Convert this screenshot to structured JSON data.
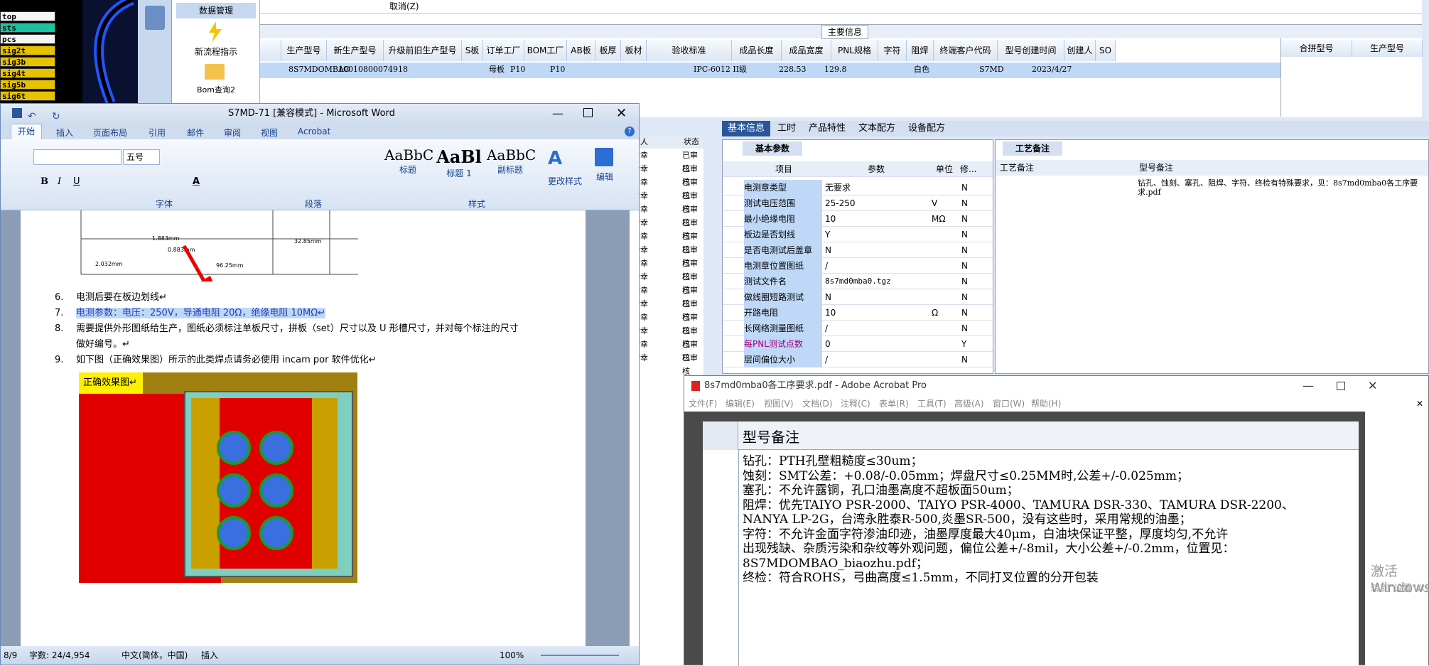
{
  "cad_layers": [
    "top",
    "sts",
    "pcs",
    "sig2t",
    "sig3b",
    "sig4t",
    "sig5b",
    "sig6t"
  ],
  "nav": {
    "data_mgmt": "数据管理",
    "new_flow": "新流程指示",
    "bom": "Bom查询2"
  },
  "erp_top": {
    "cancel": "取消(Z)",
    "main_info": "主要信息"
  },
  "grid_headers": [
    "生产型号",
    "新生产型号",
    "升级前旧生产型号",
    "S板",
    "订单工厂",
    "BOM工厂",
    "AB板",
    "板厚",
    "板材",
    "验收标准",
    "成品长度",
    "成品宽度",
    "PNL规格",
    "字符",
    "阻焊",
    "终端客户代码",
    "型号创建时间",
    "创建人",
    "SO"
  ],
  "grid_row": {
    "model": "8S7MDOMBAO",
    "new_model": "10010800074918",
    "s_board": "母板",
    "order_factory": "P10",
    "bom_factory": "P10",
    "standard": "IPC-6012 II级",
    "length": "228.53",
    "width": "129.8",
    "char": "白色",
    "customer": "S7MD",
    "created": "2023/4/27"
  },
  "right_headers": {
    "merge": "合拼型号",
    "prod": "生产型号"
  },
  "word": {
    "title": "S7MD-71 [兼容模式] - Microsoft Word",
    "tabs": [
      "开始",
      "插入",
      "页面布局",
      "引用",
      "邮件",
      "审阅",
      "视图",
      "Acrobat"
    ],
    "font_size": "五号",
    "styles": [
      "标题",
      "标题 1",
      "副标题"
    ],
    "style_sample": [
      "AaBbC",
      "AaBl",
      "AaBbC"
    ],
    "change_styles": "更改样式",
    "edit": "编辑",
    "groups": [
      "字体",
      "段落",
      "样式"
    ],
    "lines": [
      {
        "num": "6.",
        "text": "电测后要在板边划线↵"
      },
      {
        "num": "7.",
        "text": "电测参数：电压：250V，导通电阻 20Ω，绝缘电阻 10MΩ↵"
      },
      {
        "num": "8.",
        "text": "需要提供外形图纸给生产，图纸必须标注单板尺寸，拼板（set）尺寸以及 U 形槽尺寸，并对每个标注的尺寸"
      },
      {
        "num": "",
        "text": "做好编号。↵"
      },
      {
        "num": "9.",
        "text": "如下图（正确效果图）所示的此类焊点请务必使用 incam por 软件优化↵"
      }
    ],
    "drawing_dims": [
      "1.883mm",
      "0.883mm",
      "2.032mm",
      "32.85mm",
      "96.25mm"
    ],
    "img_label": "正确效果图↵",
    "status": {
      "page": "8/9",
      "words": "字数: 24/4,954",
      "lang": "中文(简体，中国)",
      "mode": "插入",
      "zoom": "100%"
    }
  },
  "midlist": {
    "col1": "审人",
    "col2": "状态",
    "name": "幸幸",
    "status": "已审核"
  },
  "param_tabs": [
    "基本信息",
    "工时",
    "产品特性",
    "文本配方",
    "设备配方"
  ],
  "basic_params": "基本参数",
  "craft_title": "工艺备注",
  "param_headers": [
    "项目",
    "参数",
    "单位",
    "修..."
  ],
  "params": [
    {
      "item": "电测章类型",
      "value": "无要求",
      "unit": "",
      "flag": "N"
    },
    {
      "item": "测试电压范围",
      "value": "25-250",
      "unit": "V",
      "flag": "N"
    },
    {
      "item": "最小绝缘电阻",
      "value": "10",
      "unit": "MΩ",
      "flag": "N"
    },
    {
      "item": "板边是否划线",
      "value": "Y",
      "unit": "",
      "flag": "N"
    },
    {
      "item": "是否电测试后盖章",
      "value": "N",
      "unit": "",
      "flag": "N"
    },
    {
      "item": "电测章位置图纸",
      "value": "/",
      "unit": "",
      "flag": "N"
    },
    {
      "item": "测试文件名",
      "value": "8s7md0mba0.tgz",
      "unit": "",
      "flag": "N"
    },
    {
      "item": "做线圈短路测试",
      "value": "N",
      "unit": "",
      "flag": "N"
    },
    {
      "item": "开路电阻",
      "value": "10",
      "unit": "Ω",
      "flag": "N"
    },
    {
      "item": "长网络测量图纸",
      "value": "/",
      "unit": "",
      "flag": "N"
    },
    {
      "item": "每PNL测试点数",
      "value": "0",
      "unit": "",
      "flag": "Y"
    },
    {
      "item": "层间偏位大小",
      "value": "/",
      "unit": "",
      "flag": "N"
    }
  ],
  "craft_headers": [
    "工艺备注",
    "型号备注"
  ],
  "craft_note": "钻孔、蚀刻、塞孔、阻焊、字符、终检有特殊要求，见：8s7md0mba0各工序要求.pdf",
  "acrobat": {
    "title": "8s7md0mba0各工序要求.pdf - Adobe Acrobat Pro",
    "menu": [
      "文件(F)",
      "编辑(E)",
      "视图(V)",
      "文档(D)",
      "注释(C)",
      "表单(R)",
      "工具(T)",
      "高级(A)",
      "窗口(W)",
      "帮助(H)"
    ],
    "heading": "型号备注",
    "lines": [
      "钻孔：PTH孔壁粗糙度≤30um；",
      "蚀刻：SMT公差：+0.08/-0.05mm；焊盘尺寸≤0.25MM时,公差+/-0.025mm；",
      "塞孔：不允许露铜，孔口油墨高度不超板面50um；",
      "阻焊：优先TAIYO PSR-2000、TAIYO PSR-4000、TAMURA  DSR-330、TAMURA DSR-2200、",
      "NANYA LP-2G，台湾永胜泰R-500,炎墨SR-500，没有这些时，采用常规的油墨；",
      "字符：不允许金面字符渗油印迹，油墨厚度最大40μm，白油块保证平整，厚度均匀,不允许",
      "出现残缺、杂质污染和杂纹等外观问题，偏位公差+/-8mil，大小公差+/-0.2mm，位置见：",
      "8S7MDOMBAO_biaozhu.pdf；",
      "终检：符合ROHS，弓曲高度≤1.5mm，不同打叉位置的分开包装"
    ]
  },
  "watermark": {
    "line1": "激活 Windows",
    "line2": "转到\"设置\"以激活 Windows。"
  },
  "colors": {
    "accent": "#2b579a",
    "highlight": "#bfd8f7",
    "red": "#e00000"
  }
}
